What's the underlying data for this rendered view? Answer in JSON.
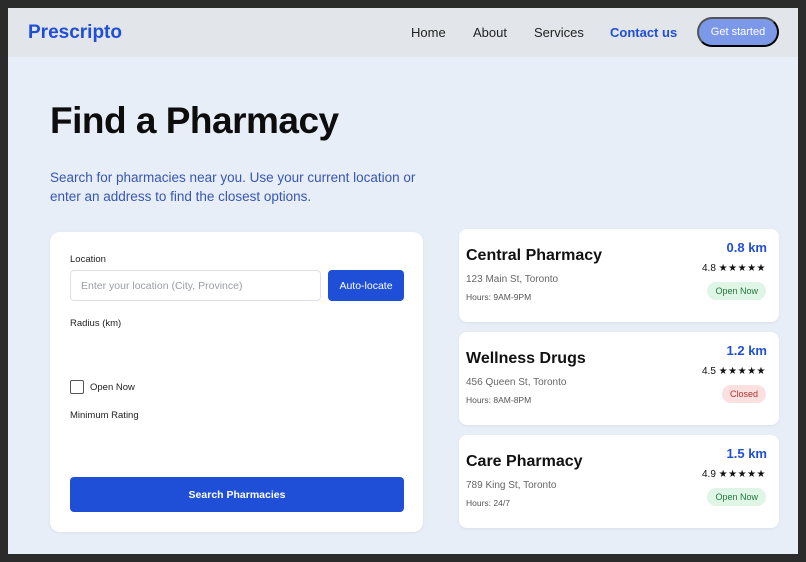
{
  "header": {
    "logo": "Prescripto",
    "nav": [
      "Home",
      "About",
      "Services",
      "Contact us"
    ],
    "cta": "Get started"
  },
  "hero": {
    "title": "Find a Pharmacy",
    "subtitle": "Search for pharmacies near you. Use your current location or enter an address to find the closest options."
  },
  "search": {
    "location_label": "Location",
    "location_placeholder": "Enter your location (City, Province)",
    "location_value": "",
    "autolocate_label": "Auto-locate",
    "radius_label": "Radius (km)",
    "open_now_label": "Open Now",
    "open_now_checked": false,
    "min_rating_label": "Minimum Rating",
    "submit_label": "Search Pharmacies"
  },
  "results": [
    {
      "name": "Central Pharmacy",
      "address": "123 Main St, Toronto",
      "hours": "Hours: 9AM-9PM",
      "distance": "0.8 km",
      "rating": "4.8",
      "stars": "★★★★★",
      "status": "Open Now",
      "status_type": "open"
    },
    {
      "name": "Wellness Drugs",
      "address": "456 Queen St, Toronto",
      "hours": "Hours: 8AM-8PM",
      "distance": "1.2 km",
      "rating": "4.5",
      "stars": "★★★★★",
      "status": "Closed",
      "status_type": "closed"
    },
    {
      "name": "Care Pharmacy",
      "address": "789 King St, Toronto",
      "hours": "Hours: 24/7",
      "distance": "1.5 km",
      "rating": "4.9",
      "stars": "★★★★★",
      "status": "Open Now",
      "status_type": "open"
    }
  ],
  "colors": {
    "brand": "#1f4fd6",
    "page_bg": "#e8eef7",
    "open_badge": "#dff5e5",
    "closed_badge": "#fbe0e0"
  }
}
